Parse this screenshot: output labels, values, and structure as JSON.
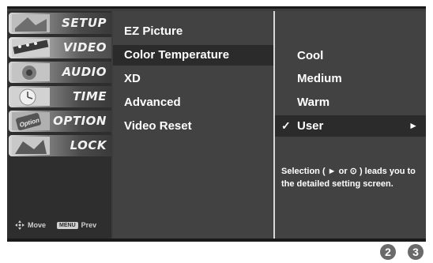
{
  "sidebar": {
    "items": [
      {
        "label": "SETUP",
        "icon": "setup-thumbnail-icon"
      },
      {
        "label": "VIDEO",
        "icon": "video-thumbnail-icon"
      },
      {
        "label": "AUDIO",
        "icon": "audio-thumbnail-icon"
      },
      {
        "label": "TIME",
        "icon": "time-thumbnail-icon"
      },
      {
        "label": "OPTION",
        "icon": "option-thumbnail-icon"
      },
      {
        "label": "LOCK",
        "icon": "lock-thumbnail-icon"
      }
    ],
    "thumb_option_text": "Option",
    "bottom": {
      "move_label": "Move",
      "menu_key": "MENU",
      "prev_label": "Prev"
    }
  },
  "menu": {
    "items": [
      "EZ Picture",
      "Color Temperature",
      "XD",
      "Advanced",
      "Video Reset"
    ],
    "selected": "Color Temperature"
  },
  "submenu": {
    "items": [
      "Cool",
      "Medium",
      "Warm",
      "User"
    ],
    "selected": "User",
    "check_mark": "✓",
    "arrow": "►",
    "help_text": "Selection ( ► or ⊙ ) leads you to the detailed setting screen."
  },
  "pages": [
    "2",
    "3"
  ],
  "colors": {
    "panel": "#424242",
    "selected": "#2b2b2b",
    "badge": "#6a6a6a"
  }
}
